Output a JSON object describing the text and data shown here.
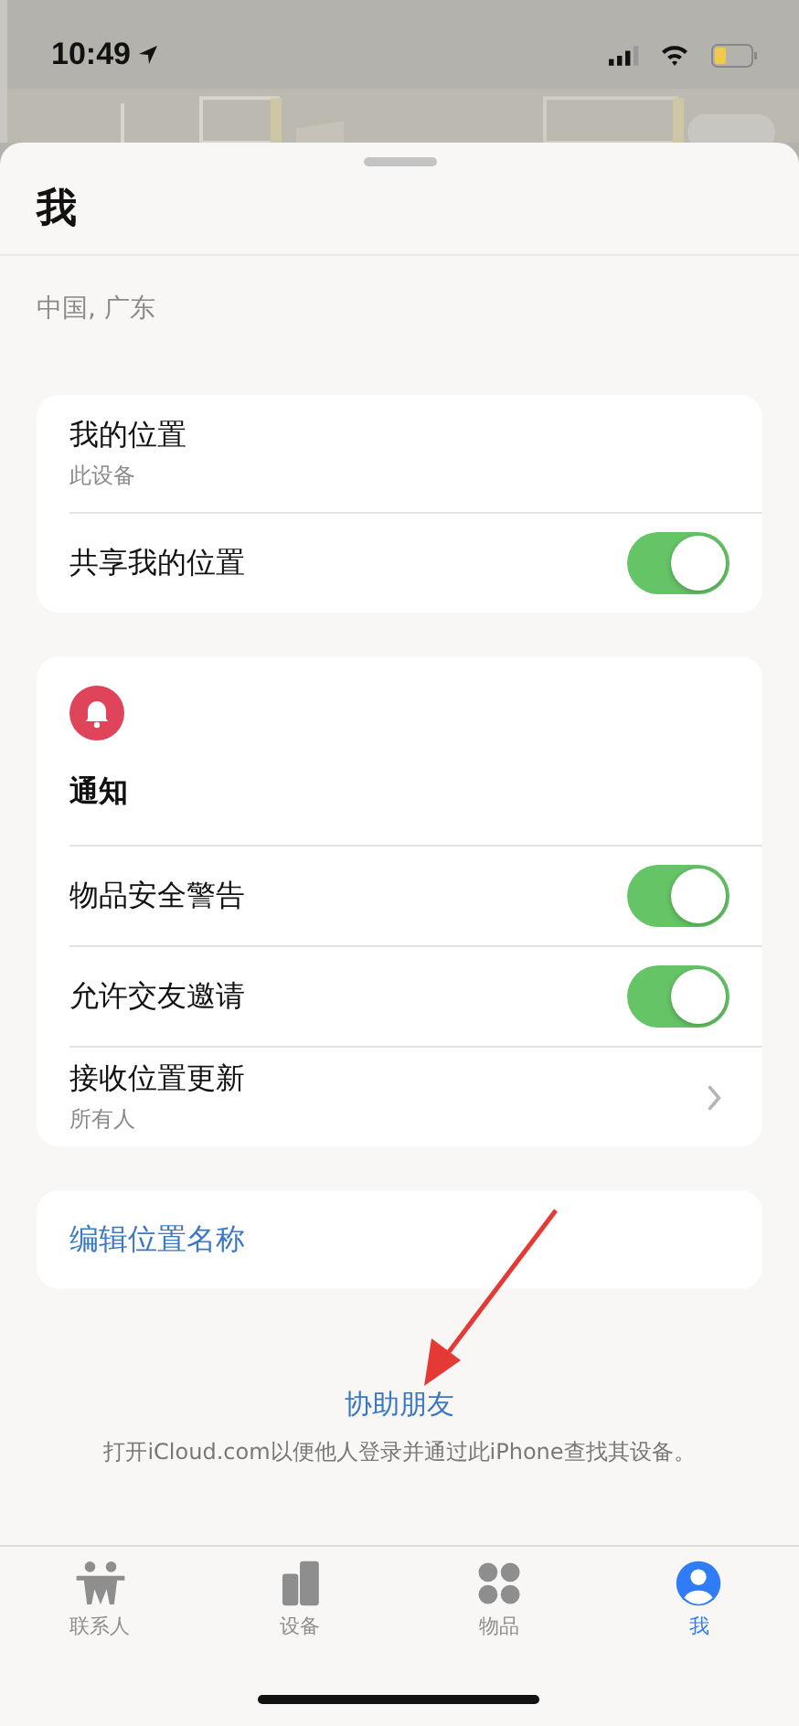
{
  "status_bar": {
    "time": "10:49"
  },
  "sheet": {
    "title": "我",
    "location": "中国, 广东"
  },
  "cards": [
    {
      "rows": [
        {
          "kind": "detail",
          "label": "我的位置",
          "sublabel": "此设备"
        },
        {
          "kind": "toggle",
          "label": "共享我的位置",
          "on": true
        }
      ]
    },
    {
      "header": {
        "kind": "bell",
        "title": "通知"
      },
      "rows": [
        {
          "kind": "toggle",
          "label": "物品安全警告",
          "on": true
        },
        {
          "kind": "toggle",
          "label": "允许交友邀请",
          "on": true
        },
        {
          "kind": "nav",
          "label": "接收位置更新",
          "sublabel": "所有人"
        }
      ]
    },
    {
      "rows": [
        {
          "kind": "link",
          "label": "编辑位置名称"
        }
      ]
    }
  ],
  "help": {
    "link": "协助朋友",
    "description": "打开iCloud.com以便他人登录并通过此iPhone查找其设备。"
  },
  "tabs": [
    {
      "label": "联系人",
      "selected": false
    },
    {
      "label": "设备",
      "selected": false
    },
    {
      "label": "物品",
      "selected": false
    },
    {
      "label": "我",
      "selected": true
    }
  ]
}
